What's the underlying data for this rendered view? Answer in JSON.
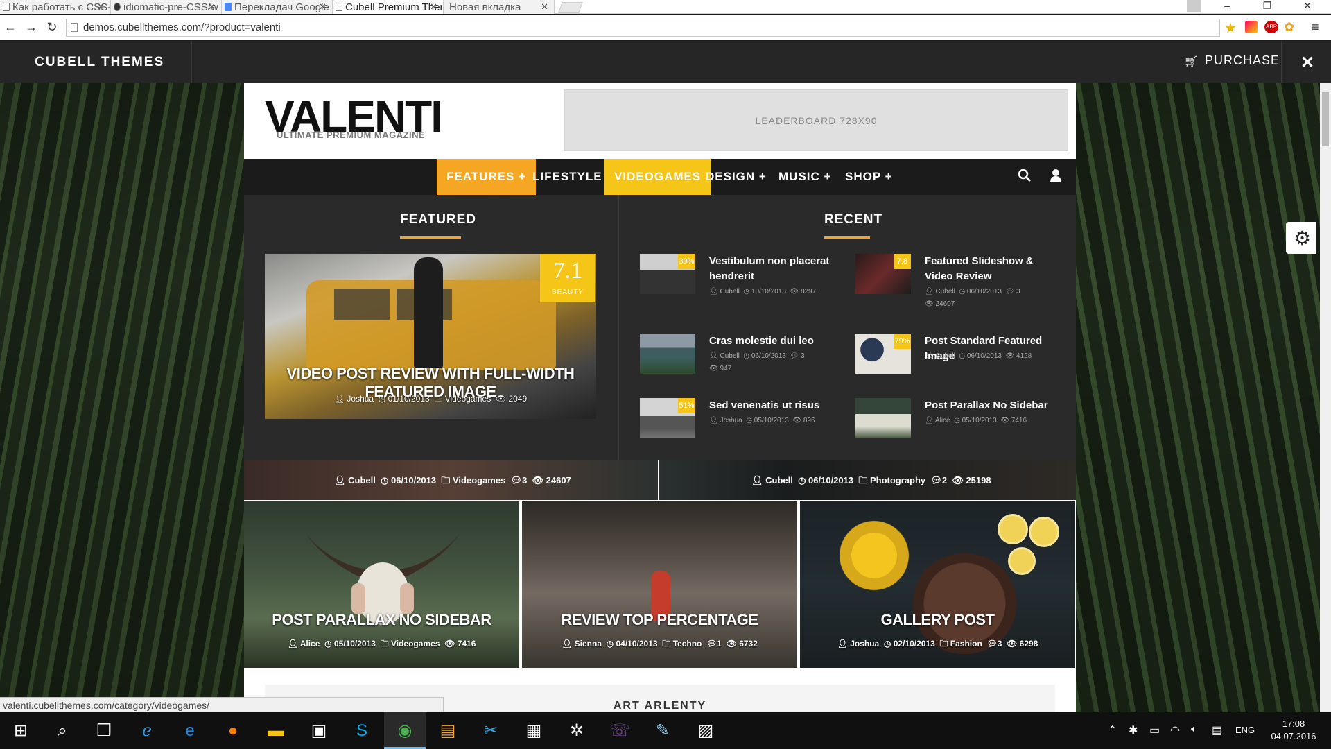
{
  "browser": {
    "tabs": [
      {
        "label": "Как работать с CSS-",
        "active": false
      },
      {
        "label": "idiomatic-pre-CSS/w",
        "active": false
      },
      {
        "label": "Переклaдач Google",
        "active": false
      },
      {
        "label": "Cubell Premium Ther",
        "active": true
      },
      {
        "label": "Новая вкладка",
        "active": false
      }
    ],
    "url": "demos.cubellthemes.com/?product=valenti",
    "status_url": "valenti.cubellthemes.com/category/videogames/"
  },
  "cubell_bar": {
    "logo": "CUBELL THEMES",
    "purchase_label": "PURCHASE",
    "close_label": "✕"
  },
  "site": {
    "logo": "VALENTI",
    "tagline": "ULTIMATE PREMIUM MAGAZINE",
    "leaderboard": "LEADERBOARD 728X90",
    "nav": [
      {
        "label": "FEATURES +",
        "style": "orange"
      },
      {
        "label": "LIFESTYLE +",
        "style": "none"
      },
      {
        "label": "VIDEOGAMES",
        "style": "yellow"
      },
      {
        "label": "DESIGN +",
        "style": "none"
      },
      {
        "label": "MUSIC +",
        "style": "none"
      },
      {
        "label": "SHOP +",
        "style": "none"
      }
    ]
  },
  "mega": {
    "featured_heading": "FEATURED",
    "recent_heading": "RECENT",
    "featured": {
      "score": "7.1",
      "score_label": "BEAUTY",
      "title": "VIDEO POST REVIEW WITH FULL-WIDTH FEATURED IMAGE",
      "author": "Joshua",
      "date": "01/10/2013",
      "category": "Videogames",
      "views": "2049"
    },
    "recent": [
      {
        "title": "Vestibulum non placerat hendrerit",
        "badge": "39%",
        "author": "Cubell",
        "date": "10/10/2013",
        "comments": "",
        "views": "8297"
      },
      {
        "title": "Featured Slideshow & Video Review",
        "badge": "7.8",
        "author": "Cubell",
        "date": "06/10/2013",
        "comments": "3",
        "views": "24607"
      },
      {
        "title": "Cras molestie dui leo",
        "badge": "",
        "author": "Cubell",
        "date": "06/10/2013",
        "comments": "3",
        "views": "947"
      },
      {
        "title": "Post Standard Featured Image",
        "badge": "79%",
        "author": "Cubell",
        "date": "06/10/2013",
        "comments": "",
        "views": "4128"
      },
      {
        "title": "Sed venenatis ut risus",
        "badge": "51%",
        "author": "Joshua",
        "date": "05/10/2013",
        "comments": "",
        "views": "896"
      },
      {
        "title": "Post Parallax No Sidebar",
        "badge": "",
        "author": "Alice",
        "date": "05/10/2013",
        "comments": "",
        "views": "7416"
      }
    ]
  },
  "strip": [
    {
      "author": "Cubell",
      "date": "06/10/2013",
      "category": "Videogames",
      "comments": "3",
      "views": "24607"
    },
    {
      "author": "Cubell",
      "date": "06/10/2013",
      "category": "Photography",
      "comments": "2",
      "views": "25198"
    }
  ],
  "tiles": [
    {
      "title": "POST PARALLAX NO SIDEBAR",
      "author": "Alice",
      "date": "05/10/2013",
      "category": "Videogames",
      "comments": "",
      "views": "7416"
    },
    {
      "title": "REVIEW TOP PERCENTAGE",
      "author": "Sienna",
      "date": "04/10/2013",
      "category": "Techno",
      "comments": "1",
      "views": "6732"
    },
    {
      "title": "GALLERY POST",
      "author": "Joshua",
      "date": "02/10/2013",
      "category": "Fashion",
      "comments": "3",
      "views": "6298"
    }
  ],
  "below_heading": "ART ARLENTY",
  "taskbar": {
    "lang": "ENG",
    "time": "17:08",
    "date": "04.07.2016"
  },
  "colors": {
    "accent_orange": "#f5a623",
    "accent_yellow": "#f5c518",
    "nav_bg": "#1b1b1b",
    "mega_bg": "#2a2a2a"
  }
}
